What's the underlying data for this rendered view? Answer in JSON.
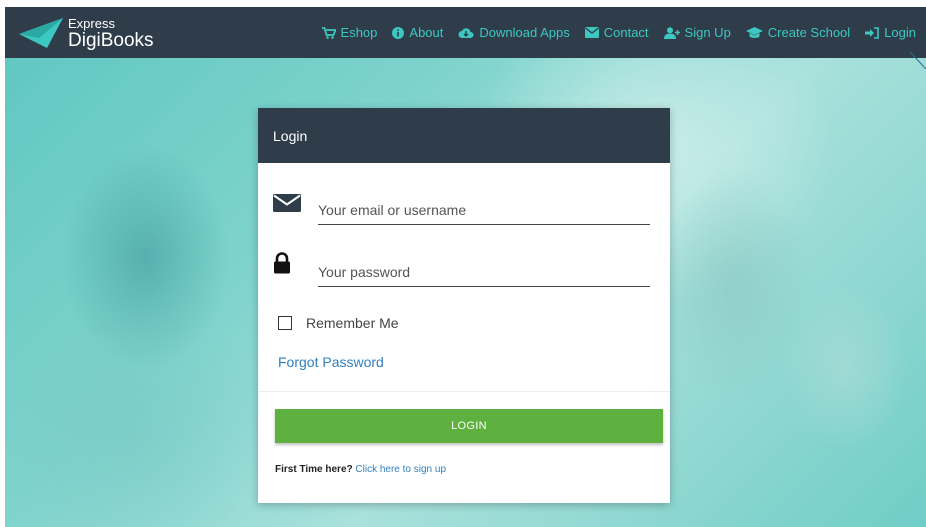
{
  "brand": {
    "line1": "Express",
    "line2": "DigiBooks"
  },
  "nav": {
    "items": [
      {
        "label": "Eshop",
        "icon": "cart-icon"
      },
      {
        "label": "About",
        "icon": "info-icon"
      },
      {
        "label": "Download Apps",
        "icon": "cloud-download-icon"
      },
      {
        "label": "Contact",
        "icon": "envelope-icon"
      },
      {
        "label": "Sign Up",
        "icon": "user-plus-icon"
      },
      {
        "label": "Create School",
        "icon": "graduation-cap-icon"
      },
      {
        "label": "Login",
        "icon": "sign-in-icon"
      }
    ]
  },
  "login": {
    "title": "Login",
    "email_placeholder": "Your email or username",
    "password_placeholder": "Your password",
    "remember_label": "Remember Me",
    "remember_checked": false,
    "forgot_label": "Forgot Password",
    "submit_label": "LOGIN",
    "first_time_text": "First Time here?",
    "signup_link_label": "Click here to sign up"
  },
  "colors": {
    "topbar": "#2f3d4b",
    "nav_accent": "#3cc7c0",
    "submit": "#5fb13f",
    "link": "#2f7fc0"
  }
}
